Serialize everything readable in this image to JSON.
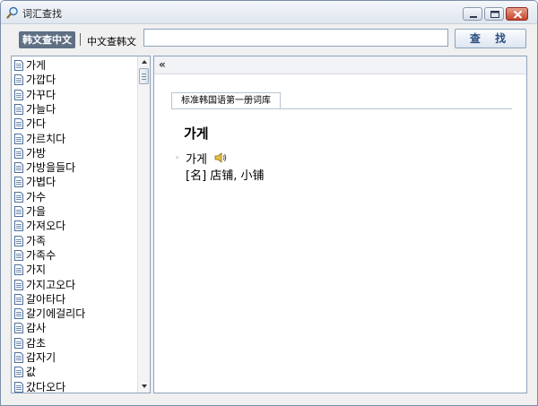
{
  "window": {
    "title": "词汇查找"
  },
  "toolbar": {
    "mode_korean_to_chinese": "韩文查中文",
    "mode_chinese_to_korean": "中文查韩文",
    "search_value": "",
    "search_button": "查 找"
  },
  "word_list": [
    "가게",
    "가깝다",
    "가꾸다",
    "가늘다",
    "가다",
    "가르치다",
    "가방",
    "가방을들다",
    "가볍다",
    "가수",
    "가을",
    "가져오다",
    "가족",
    "가족수",
    "가지",
    "가지고오다",
    "갈아타다",
    "갈기에걸리다",
    "감사",
    "감초",
    "감자기",
    "값",
    "갔다오다"
  ],
  "detail": {
    "collapse_label": "«",
    "dictionary_tab": "标准韩国语第一册词库",
    "headword": "가게",
    "entry_word": "가게",
    "definition": "[名] 店铺, 小铺"
  },
  "icons": {
    "list_item": "document-icon",
    "audio": "speaker-icon"
  },
  "colors": {
    "active_mode_bg": "#5f6f84",
    "border": "#8da2bd",
    "search_text": "#2b4b7e"
  }
}
